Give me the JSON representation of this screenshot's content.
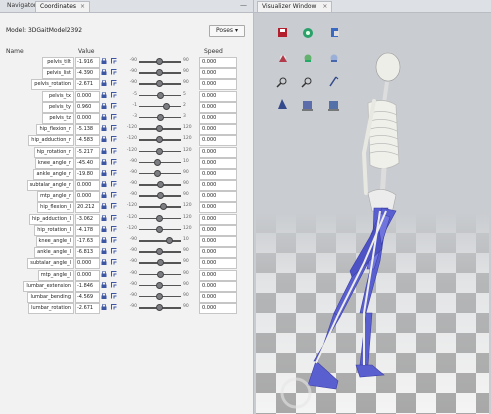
{
  "left_panel": {
    "tabs": [
      {
        "label": "Navigator"
      },
      {
        "label": "Coordinates",
        "close": "×"
      }
    ],
    "minimize": "—",
    "model_label": "Model: 3DGaitModel2392",
    "poses_button": "Poses ▾",
    "headers": {
      "name": "Name",
      "value": "Value",
      "speed": "Speed"
    },
    "rows": [
      {
        "name": "pelvis_tilt",
        "value": "-1.916",
        "min": "-90",
        "max": "90",
        "pos": 0.49,
        "speed": "0.000"
      },
      {
        "name": "pelvis_list",
        "value": "-4.390",
        "min": "-90",
        "max": "90",
        "pos": 0.48,
        "speed": "0.000"
      },
      {
        "name": "pelvis_rotation",
        "value": "-2.671",
        "min": "-90",
        "max": "90",
        "pos": 0.49,
        "speed": "0.000"
      },
      {
        "name": "pelvis_tx",
        "value": "0.000",
        "min": "-5",
        "max": "5",
        "pos": 0.5,
        "speed": "0.000"
      },
      {
        "name": "pelvis_ty",
        "value": "0.960",
        "min": "-1",
        "max": "2",
        "pos": 0.65,
        "speed": "0.000"
      },
      {
        "name": "pelvis_tz",
        "value": "0.000",
        "min": "-3",
        "max": "3",
        "pos": 0.5,
        "speed": "0.000"
      },
      {
        "name": "hip_flexion_r",
        "value": "-5.138",
        "min": "-120",
        "max": "120",
        "pos": 0.48,
        "speed": "0.000"
      },
      {
        "name": "hip_adduction_r",
        "value": "-4.583",
        "min": "-120",
        "max": "120",
        "pos": 0.48,
        "speed": "0.000"
      },
      {
        "name": "hip_rotation_r",
        "value": "-5.217",
        "min": "-120",
        "max": "120",
        "pos": 0.48,
        "speed": "0.000"
      },
      {
        "name": "knee_angle_r",
        "value": "-45.40",
        "min": "-90",
        "max": "10",
        "pos": 0.45,
        "speed": "0.000"
      },
      {
        "name": "ankle_angle_r",
        "value": "-19.80",
        "min": "-90",
        "max": "90",
        "pos": 0.45,
        "speed": "0.000"
      },
      {
        "name": "subtalar_angle_r",
        "value": "0.000",
        "min": "-90",
        "max": "90",
        "pos": 0.5,
        "speed": "0.000"
      },
      {
        "name": "mtp_angle_r",
        "value": "0.000",
        "min": "-90",
        "max": "90",
        "pos": 0.5,
        "speed": "0.000"
      },
      {
        "name": "hip_flexion_l",
        "value": "20.212",
        "min": "-120",
        "max": "120",
        "pos": 0.58,
        "speed": "0.000"
      },
      {
        "name": "hip_adduction_l",
        "value": "-3.062",
        "min": "-120",
        "max": "120",
        "pos": 0.49,
        "speed": "0.000"
      },
      {
        "name": "hip_rotation_l",
        "value": "-4.178",
        "min": "-120",
        "max": "120",
        "pos": 0.48,
        "speed": "0.000"
      },
      {
        "name": "knee_angle_l",
        "value": "-17.63",
        "min": "-90",
        "max": "10",
        "pos": 0.73,
        "speed": "0.000"
      },
      {
        "name": "ankle_angle_l",
        "value": "-6.813",
        "min": "-90",
        "max": "90",
        "pos": 0.48,
        "speed": "0.000"
      },
      {
        "name": "subtalar_angle_l",
        "value": "0.000",
        "min": "-90",
        "max": "90",
        "pos": 0.5,
        "speed": "0.000"
      },
      {
        "name": "mtp_angle_l",
        "value": "0.000",
        "min": "-90",
        "max": "90",
        "pos": 0.5,
        "speed": "0.000"
      },
      {
        "name": "lumbar_extension",
        "value": "-1.846",
        "min": "-90",
        "max": "90",
        "pos": 0.49,
        "speed": "0.000"
      },
      {
        "name": "lumbar_bending",
        "value": "-4.569",
        "min": "-90",
        "max": "90",
        "pos": 0.48,
        "speed": "0.000"
      },
      {
        "name": "lumbar_rotation",
        "value": "-2.671",
        "min": "-90",
        "max": "90",
        "pos": 0.49,
        "speed": "0.000"
      }
    ],
    "lock_icon": "lock-icon",
    "clamp_icon": "clamp-icon"
  },
  "viewer": {
    "tab_label": "Visualizer Window",
    "tab_close": "×",
    "toolbar_icons": [
      "save-image-icon",
      "record-movie-icon",
      "model-icon",
      "front-view-icon",
      "side-view-icon",
      "top-view-icon",
      "zoom-in-icon",
      "zoom-out-icon",
      "pan-icon",
      "perspective-icon",
      "axes-icon",
      "settings-icon"
    ],
    "colors": {
      "muscle": "#5a5fcf",
      "bone": "#f0f0ea",
      "floor_light": "#f4f4f4",
      "floor_dark": "#a8a8a8",
      "background": "#c9ccd0"
    }
  }
}
